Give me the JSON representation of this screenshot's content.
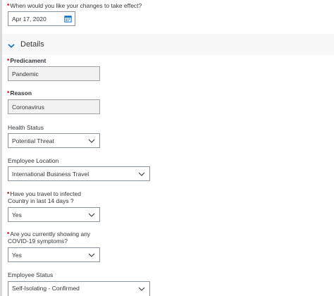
{
  "effective_date": {
    "required_mark": "*",
    "label": "When would you like your changes to take effect?",
    "value": "Apr 17, 2020",
    "icon": "calendar-icon"
  },
  "section": {
    "title": "Details",
    "icon": "chevron-down-icon"
  },
  "fields": {
    "predicament": {
      "required_mark": "*",
      "label": "Predicament",
      "value": "Pandemic"
    },
    "reason": {
      "required_mark": "*",
      "label": "Reason",
      "value": "Coronavirus"
    },
    "health_status": {
      "label": "Health Status",
      "value": "Potential Threat"
    },
    "employee_location": {
      "label": "Employee Location",
      "value": "International Business Travel"
    },
    "travel": {
      "required_mark": "*",
      "label_line1": "Have you travel to infected",
      "label_line2": "Country in last 14 days ?",
      "value": "Yes"
    },
    "symptoms": {
      "required_mark": "*",
      "label_line1": "Are you currently showing any",
      "label_line2": "COVID-19 symptoms?",
      "value": "Yes"
    },
    "employee_status": {
      "label": "Employee Status",
      "value": "Self-Isolating - Confirmed"
    }
  },
  "colors": {
    "required": "#bb0000",
    "accent": "#0a6ed1",
    "border": "#89919a"
  }
}
